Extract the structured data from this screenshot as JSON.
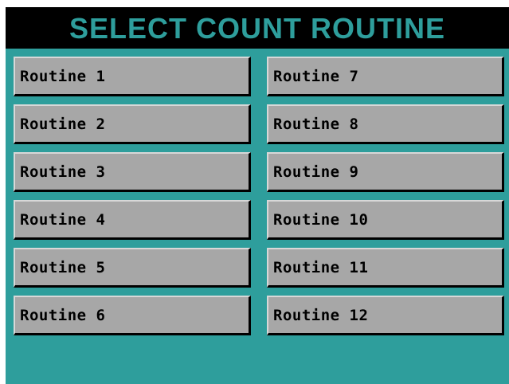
{
  "screen": {
    "title": "SELECT COUNT ROUTINE"
  },
  "colors": {
    "panel_background": "#2e9e9c",
    "title_background": "#000000",
    "title_text": "#2e9e9c",
    "button_face": "#a7a7a7"
  },
  "routines": {
    "left": [
      {
        "label": "Routine 1"
      },
      {
        "label": "Routine 2"
      },
      {
        "label": "Routine 3"
      },
      {
        "label": "Routine 4"
      },
      {
        "label": "Routine 5"
      },
      {
        "label": "Routine 6"
      }
    ],
    "right": [
      {
        "label": "Routine 7"
      },
      {
        "label": "Routine 8"
      },
      {
        "label": "Routine 9"
      },
      {
        "label": "Routine 10"
      },
      {
        "label": "Routine 11"
      },
      {
        "label": "Routine 12"
      }
    ]
  }
}
